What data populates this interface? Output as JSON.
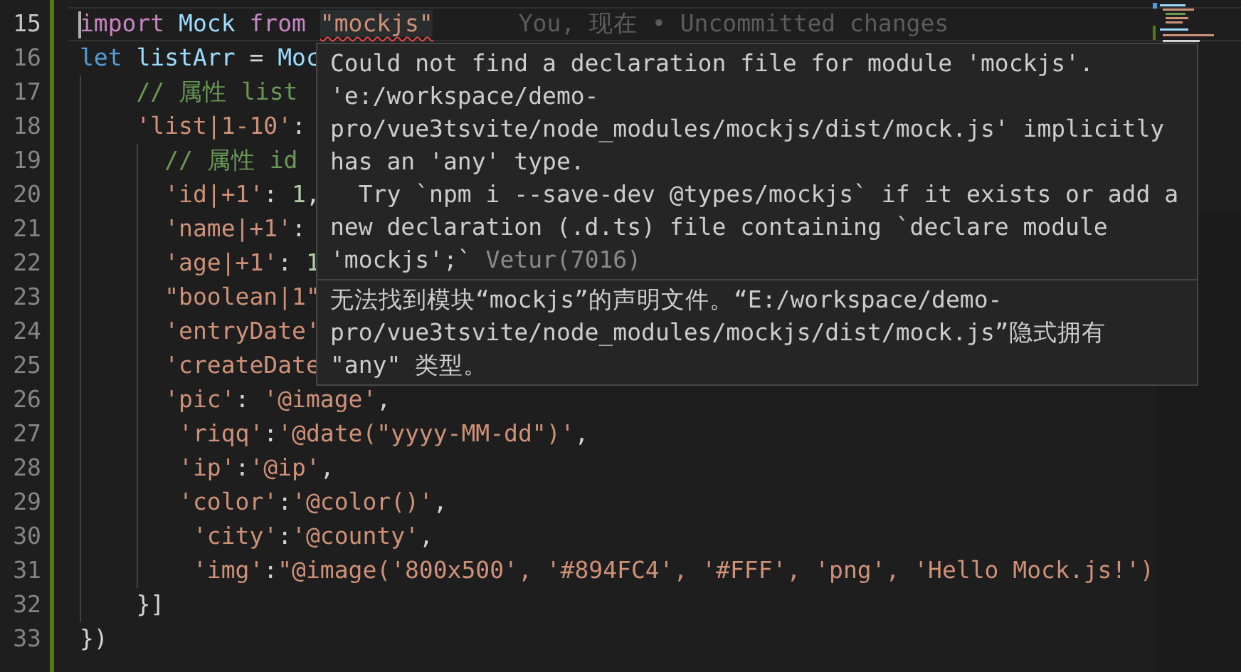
{
  "editor": {
    "lines": [
      {
        "number": "15",
        "active": true,
        "blame": "You, 现在 • Uncommitted changes",
        "tokens": [
          {
            "text": "import",
            "kind": "keyword",
            "error": false
          },
          {
            "text": " Mock",
            "kind": "variable",
            "error": false
          },
          {
            "text": " from ",
            "kind": "keyword",
            "error": false
          },
          {
            "text": "\"mockjs\"",
            "kind": "string",
            "error": true
          }
        ]
      },
      {
        "number": "16",
        "active": false,
        "tokens": [
          {
            "text": "let",
            "kind": "storage"
          },
          {
            "text": " listArr",
            "kind": "variable"
          },
          {
            "text": " = ",
            "kind": "punct"
          },
          {
            "text": "Moc",
            "kind": "variable"
          }
        ]
      },
      {
        "number": "17",
        "active": false,
        "tokens": [
          {
            "text": "    // 属性 list",
            "kind": "comment"
          }
        ]
      },
      {
        "number": "18",
        "active": false,
        "tokens": [
          {
            "text": "    'list|1-10'",
            "kind": "string"
          },
          {
            "text": ": ",
            "kind": "punct"
          }
        ]
      },
      {
        "number": "19",
        "active": false,
        "tokens": [
          {
            "text": "      // 属性 id",
            "kind": "comment"
          }
        ]
      },
      {
        "number": "20",
        "active": false,
        "tokens": [
          {
            "text": "      'id|+1'",
            "kind": "string"
          },
          {
            "text": ": ",
            "kind": "punct"
          },
          {
            "text": "1",
            "kind": "number"
          },
          {
            "text": ",",
            "kind": "punct"
          }
        ]
      },
      {
        "number": "21",
        "active": false,
        "tokens": [
          {
            "text": "      'name|+1'",
            "kind": "string"
          },
          {
            "text": ": ",
            "kind": "punct"
          }
        ]
      },
      {
        "number": "22",
        "active": false,
        "tokens": [
          {
            "text": "      'age|+1'",
            "kind": "string"
          },
          {
            "text": ": ",
            "kind": "punct"
          },
          {
            "text": "1",
            "kind": "number"
          }
        ]
      },
      {
        "number": "23",
        "active": false,
        "tokens": [
          {
            "text": "      \"boolean|1\"",
            "kind": "string"
          }
        ]
      },
      {
        "number": "24",
        "active": false,
        "tokens": [
          {
            "text": "      'entryDate'",
            "kind": "string"
          }
        ]
      },
      {
        "number": "25",
        "active": false,
        "tokens": [
          {
            "text": "      'createDate",
            "kind": "string"
          }
        ]
      },
      {
        "number": "26",
        "active": false,
        "tokens": [
          {
            "text": "      'pic'",
            "kind": "string"
          },
          {
            "text": ": ",
            "kind": "punct"
          },
          {
            "text": "'@image'",
            "kind": "string"
          },
          {
            "text": ",",
            "kind": "punct"
          }
        ]
      },
      {
        "number": "27",
        "active": false,
        "tokens": [
          {
            "text": "       'riqq'",
            "kind": "string"
          },
          {
            "text": ":",
            "kind": "punct"
          },
          {
            "text": "'@date(\"yyyy-MM-dd\")'",
            "kind": "string"
          },
          {
            "text": ",",
            "kind": "punct"
          }
        ]
      },
      {
        "number": "28",
        "active": false,
        "tokens": [
          {
            "text": "       'ip'",
            "kind": "string"
          },
          {
            "text": ":",
            "kind": "punct"
          },
          {
            "text": "'@ip'",
            "kind": "string"
          },
          {
            "text": ",",
            "kind": "punct"
          }
        ]
      },
      {
        "number": "29",
        "active": false,
        "tokens": [
          {
            "text": "       'color'",
            "kind": "string"
          },
          {
            "text": ":",
            "kind": "punct"
          },
          {
            "text": "'@color()'",
            "kind": "string"
          },
          {
            "text": ",",
            "kind": "punct"
          }
        ]
      },
      {
        "number": "30",
        "active": false,
        "tokens": [
          {
            "text": "        'city'",
            "kind": "string"
          },
          {
            "text": ":",
            "kind": "punct"
          },
          {
            "text": "'@county'",
            "kind": "string"
          },
          {
            "text": ",",
            "kind": "punct"
          }
        ]
      },
      {
        "number": "31",
        "active": false,
        "tokens": [
          {
            "text": "        'img'",
            "kind": "string"
          },
          {
            "text": ":",
            "kind": "punct"
          },
          {
            "text": "\"@image('800x500', '#894FC4', '#FFF', 'png', 'Hello Mock.js!')",
            "kind": "string"
          }
        ]
      },
      {
        "number": "32",
        "active": false,
        "tokens": [
          {
            "text": "    }]",
            "kind": "punct"
          }
        ]
      },
      {
        "number": "33",
        "active": false,
        "tokens": [
          {
            "text": "})",
            "kind": "punct"
          }
        ]
      }
    ]
  },
  "hover_tooltip": {
    "message": "Could not find a declaration file for module 'mockjs'.\n'e:/workspace/demo-\npro/vue3tsvite/node_modules/mockjs/dist/mock.js' implicitly\nhas an 'any' type.\n  Try `npm i --save-dev @types/mockjs` if it exists or add a\nnew declaration (.d.ts) file containing `declare module\n'mockjs';`",
    "source": "Vetur(7016)",
    "translation": "无法找到模块“mockjs”的声明文件。“E:/workspace/demo-\npro/vue3tsvite/node_modules/mockjs/dist/mock.js”隐式拥有\n\"any\" 类型。"
  }
}
